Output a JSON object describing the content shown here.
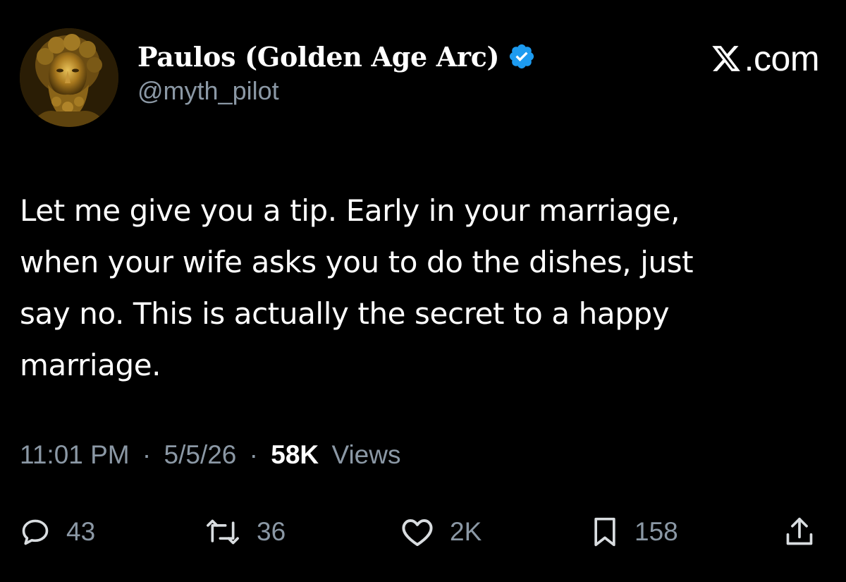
{
  "author": {
    "display_name": "Paulos (Golden Age Arc)",
    "handle": "@myth_pilot",
    "verified": true,
    "avatar_icon": "golden-bust-avatar"
  },
  "brand": {
    "label": ".com",
    "icon": "x-logo-icon"
  },
  "tweet": {
    "text_lines": [
      "Let me give you a tip. Early in your marriage,",
      "when your wife asks you to do the dishes, just",
      "say no. This is actually the secret to a happy",
      "marriage."
    ]
  },
  "meta": {
    "time": "11:01 PM",
    "date": "5/5/26",
    "views_count": "58K",
    "views_label": "Views",
    "separator": "·"
  },
  "actions": {
    "reply": {
      "icon": "reply-icon",
      "count": "43"
    },
    "retweet": {
      "icon": "retweet-icon",
      "count": "36"
    },
    "like": {
      "icon": "heart-icon",
      "count": "2K"
    },
    "bookmark": {
      "icon": "bookmark-icon",
      "count": "158"
    },
    "share": {
      "icon": "share-icon"
    }
  },
  "colors": {
    "background": "#000000",
    "text_primary": "#ffffff",
    "text_secondary": "#8b98a5",
    "verified_badge": "#1d9bf0",
    "avatar_gold": "#b8892a"
  }
}
